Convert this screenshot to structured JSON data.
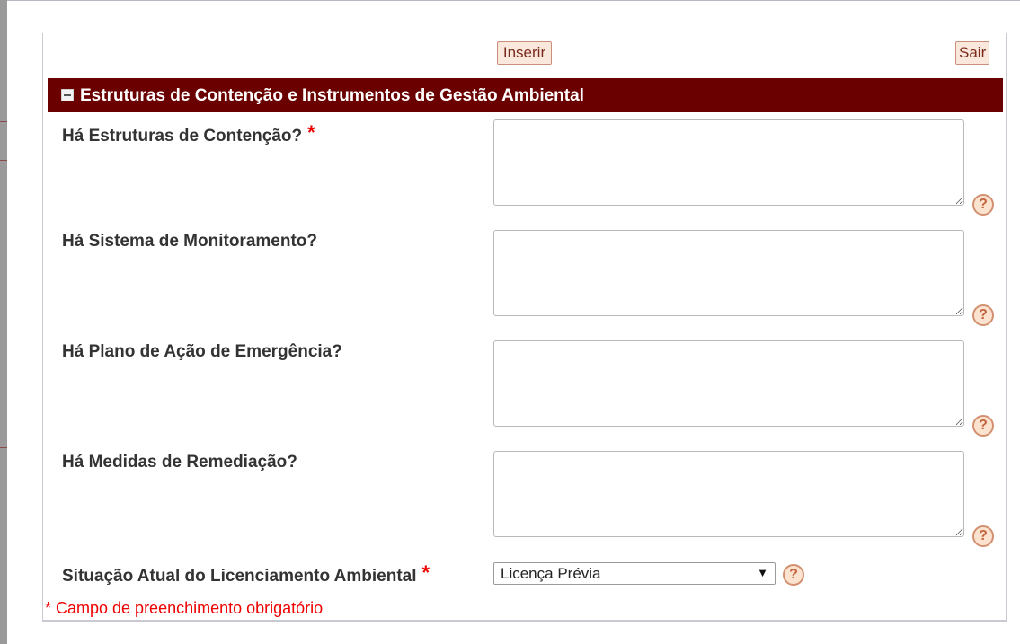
{
  "toolbar": {
    "insert_label": "Inserir",
    "exit_label": "Sair"
  },
  "section": {
    "collapse_symbol": "−",
    "title": "Estruturas de Contenção e Instrumentos de Gestão Ambiental"
  },
  "fields": [
    {
      "label": "Há Estruturas de Contenção?",
      "required": true,
      "value": ""
    },
    {
      "label": "Há Sistema de Monitoramento?",
      "required": false,
      "value": ""
    },
    {
      "label": "Há Plano de Ação de Emergência?",
      "required": false,
      "value": ""
    },
    {
      "label": "Há Medidas de Remediação?",
      "required": false,
      "value": ""
    }
  ],
  "licensing": {
    "label": "Situação Atual do Licenciamento Ambiental",
    "required": true,
    "selected": "Licença Prévia",
    "arrow": "▼"
  },
  "required_marker": "*",
  "help_symbol": "?",
  "footnote": "* Campo de preenchimento obrigatório",
  "colors": {
    "header_bg": "#6b0000",
    "required": "#ee0000",
    "button_bg": "#fbe8dc",
    "help_icon": "#c5653f"
  }
}
